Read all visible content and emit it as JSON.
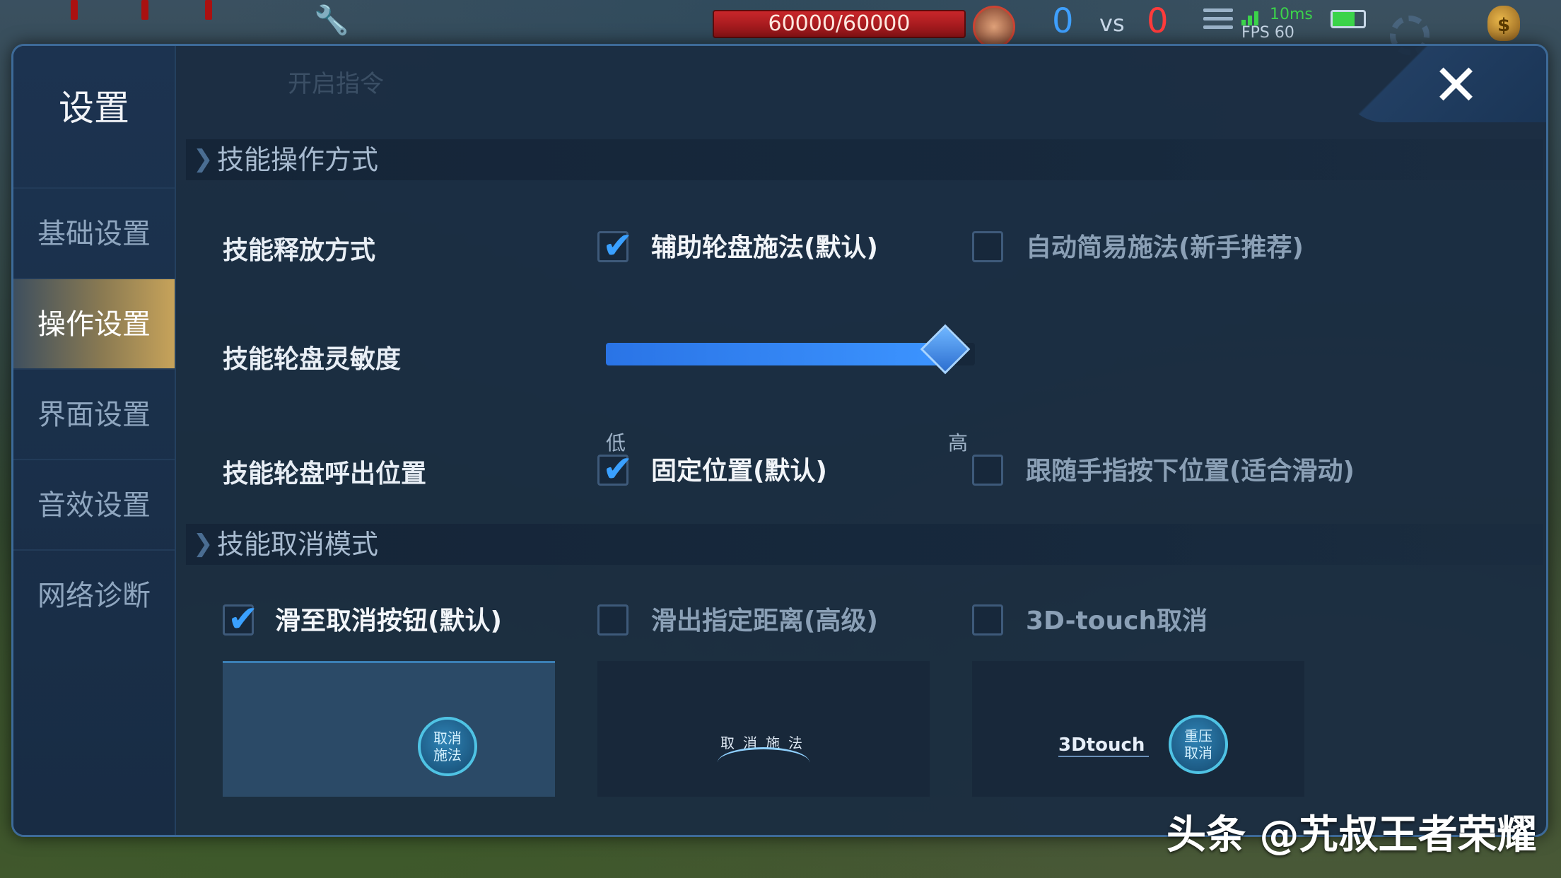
{
  "hud": {
    "hp": "60000/60000",
    "score_blue": "0",
    "vs": "vs",
    "score_red": "0",
    "ping": "10ms",
    "fps": "FPS 60"
  },
  "modal": {
    "title": "设置",
    "close": "✕",
    "sidebar": [
      {
        "label": "基础设置",
        "active": false
      },
      {
        "label": "操作设置",
        "active": true
      },
      {
        "label": "界面设置",
        "active": false
      },
      {
        "label": "音效设置",
        "active": false
      },
      {
        "label": "网络诊断",
        "active": false
      }
    ],
    "ghost_text": {
      "command": "开启指令"
    }
  },
  "section1": {
    "header": "技能操作方式",
    "release": {
      "label": "技能释放方式",
      "opt1": {
        "label": "辅助轮盘施法(默认)",
        "checked": true
      },
      "opt2": {
        "label": "自动简易施法(新手推荐)",
        "checked": false
      }
    },
    "sensitivity": {
      "label": "技能轮盘灵敏度",
      "value": 1.0,
      "low": "低",
      "high": "高"
    },
    "position": {
      "label": "技能轮盘呼出位置",
      "opt1": {
        "label": "固定位置(默认)",
        "checked": true
      },
      "opt2": {
        "label": "跟随手指按下位置(适合滑动)",
        "checked": false
      }
    }
  },
  "section2": {
    "header": "技能取消模式",
    "opt1": {
      "label": "滑至取消按钮(默认)",
      "checked": true
    },
    "opt2": {
      "label": "滑出指定距离(高级)",
      "checked": false
    },
    "opt3": {
      "label": "3D-touch取消",
      "checked": false
    },
    "preview1_btn": "取消\n施法",
    "preview2_arc": "取消施法",
    "preview3_label": "3Dtouch",
    "preview3_btn": "重压\n取消"
  },
  "watermark": "头条 @艽叔王者荣耀",
  "colors": {
    "accent": "#3aa0ff",
    "active_tab": "#c7a35a"
  }
}
